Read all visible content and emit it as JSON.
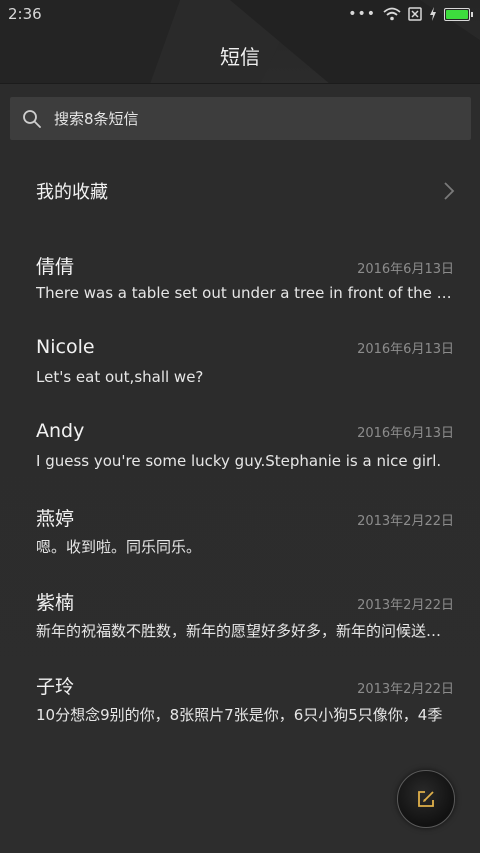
{
  "status": {
    "time": "2:36",
    "dots": "•••",
    "battery_level": 1.0,
    "battery_color": "#3ddc3d"
  },
  "header": {
    "title": "短信"
  },
  "search": {
    "placeholder": "搜索8条短信"
  },
  "favorites": {
    "label": "我的收藏"
  },
  "messages": [
    {
      "name": "倩倩",
      "date": "2016年6月13日",
      "preview": "There was a table set out under a tree in front of the house"
    },
    {
      "name": "Nicole",
      "date": "2016年6月13日",
      "preview": "Let's eat out,shall we?"
    },
    {
      "name": "Andy",
      "date": "2016年6月13日",
      "preview": "I guess you're some lucky guy.Stephanie is a nice girl."
    },
    {
      "name": "燕婷",
      "date": "2013年2月22日",
      "preview": "嗯。收到啦。同乐同乐。"
    },
    {
      "name": "紫楠",
      "date": "2013年2月22日",
      "preview": "新年的祝福数不胜数，新年的愿望好多好多，新年的问候送给你"
    },
    {
      "name": "子玲",
      "date": "2013年2月22日",
      "preview": "10分想念9别的你，8张照片7张是你，6只小狗5只像你，4季"
    }
  ],
  "icons": {
    "search": "search-icon",
    "chevron": "chevron-right-icon",
    "compose": "compose-icon",
    "wifi": "wifi-icon",
    "sim": "no-sim-icon",
    "charging": "charging-icon",
    "battery": "battery-icon"
  }
}
